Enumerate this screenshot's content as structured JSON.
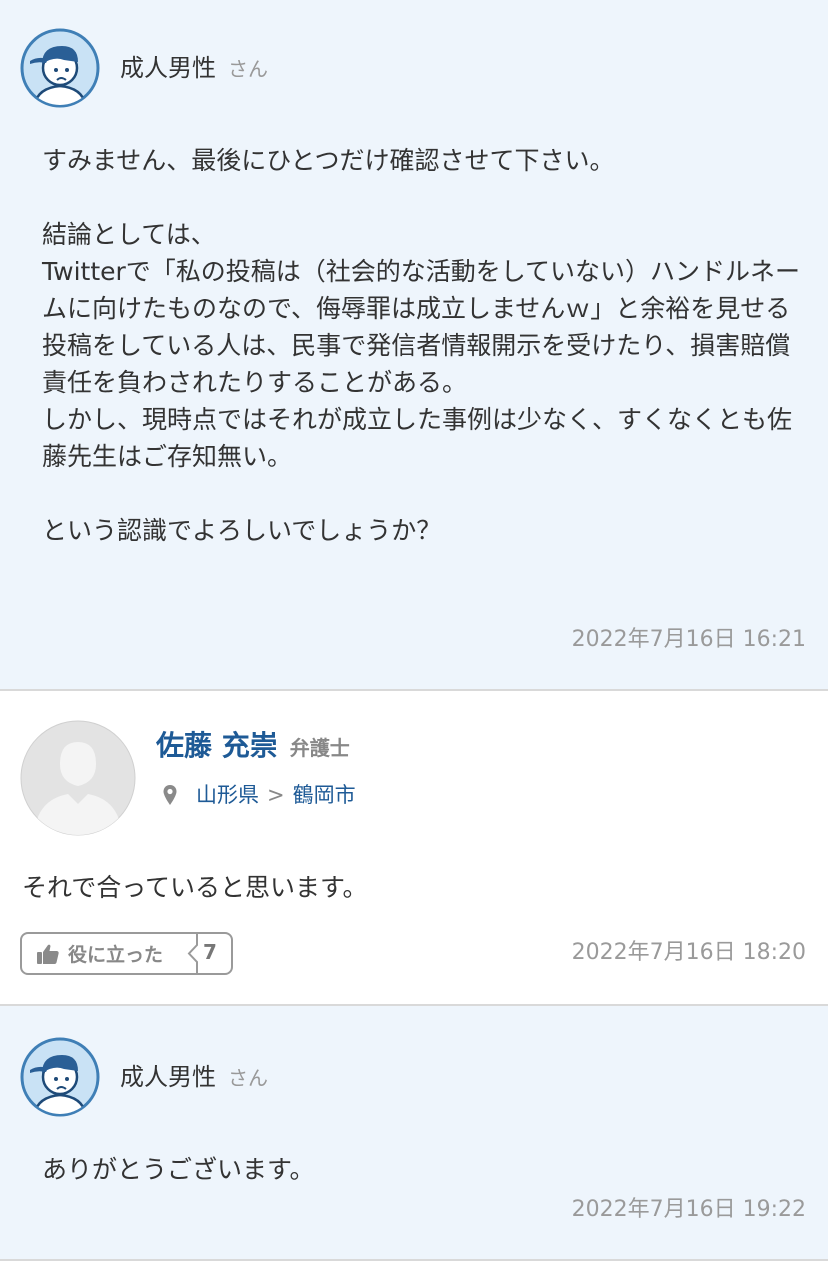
{
  "posts": [
    {
      "author": "成人男性",
      "suffix": "さん",
      "body": "すみません、最後にひとつだけ確認させて下さい。\n\n結論としては、\nTwitterで「私の投稿は（社会的な活動をしていない）ハンドルネームに向けたものなので、侮辱罪は成立しませんｗ」と余裕を見せる投稿をしている人は、民事で発信者情報開示を受けたり、損害賠償責任を負わされたりすることがある。\nしかし、現時点ではそれが成立した事例は少なく、すくなくとも佐藤先生はご存知無い。\n\nという認識でよろしいでしょうか？",
      "timestamp": "2022年7月16日 16:21"
    },
    {
      "author": "佐藤 充崇",
      "title": "弁護士",
      "prefecture": "山形県",
      "separator": ">",
      "city": "鶴岡市",
      "body": "それで合っていると思います。",
      "helpful_label": "役に立った",
      "helpful_count": "7",
      "timestamp": "2022年7月16日 18:20"
    },
    {
      "author": "成人男性",
      "suffix": "さん",
      "body": "ありがとうございます。",
      "timestamp": "2022年7月16日 19:22"
    }
  ],
  "icons": {
    "user_avatar": "user-avatar-icon",
    "lawyer_avatar": "default-avatar-icon",
    "location": "location-pin-icon",
    "helpful": "thumbs-up-icon"
  },
  "colors": {
    "user_bg": "#eef5fc",
    "link_blue": "#1e5a96",
    "muted": "#9a9a9a"
  }
}
